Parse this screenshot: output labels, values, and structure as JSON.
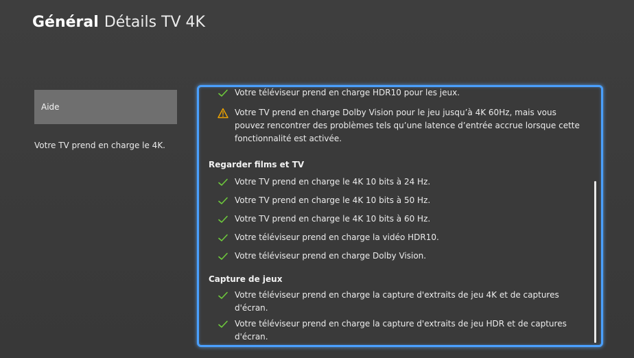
{
  "header": {
    "section": "Général",
    "title": "Détails TV 4K"
  },
  "sidebar": {
    "help_label": "Aide",
    "description": "Votre TV prend en charge le 4K."
  },
  "details": {
    "game_items": [
      {
        "status": "ok",
        "text": "Votre téléviseur prend en charge HDR10 pour les jeux."
      },
      {
        "status": "warning",
        "text": "Votre TV prend en charge Dolby Vision pour le jeu jusqu’à 4K 60Hz, mais vous pouvez rencontrer des problèmes tels qu’une latence d’entrée accrue lorsque cette fonctionnalité est activée."
      }
    ],
    "movies_title": "Regarder films et TV",
    "movies_items": [
      {
        "status": "ok",
        "text": "Votre TV prend en charge le 4K 10 bits à 24 Hz."
      },
      {
        "status": "ok",
        "text": "Votre TV prend en charge le 4K 10 bits à 50 Hz."
      },
      {
        "status": "ok",
        "text": "Votre TV prend en charge le 4K 10 bits à 60 Hz."
      },
      {
        "status": "ok",
        "text": "Votre téléviseur prend en charge la vidéo HDR10."
      },
      {
        "status": "ok",
        "text": "Votre téléviseur prend en charge Dolby Vision."
      }
    ],
    "capture_title": "Capture de jeux",
    "capture_items": [
      {
        "status": "ok",
        "text": "Votre téléviseur prend en charge la capture d'extraits de jeu 4K et de captures d'écran."
      },
      {
        "status": "ok",
        "text": "Votre téléviseur prend en charge la capture d'extraits de jeu HDR et de captures d'écran."
      }
    ]
  },
  "colors": {
    "check": "#6ecb3c",
    "warning": "#f0a500",
    "focus_border": "#4aa0ff"
  },
  "icons": {
    "ok": "check-icon",
    "warning": "warning-icon"
  }
}
